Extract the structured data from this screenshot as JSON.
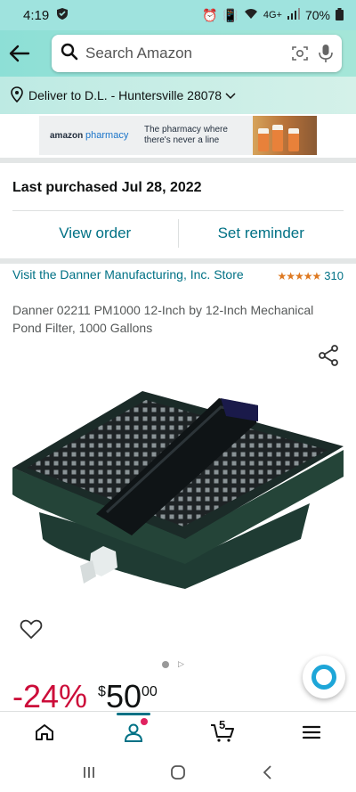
{
  "status_bar": {
    "time": "4:19",
    "network": "4G+",
    "battery": "70%"
  },
  "search": {
    "placeholder": "Search Amazon"
  },
  "delivery": {
    "text": "Deliver to D.L. - Huntersville 28078"
  },
  "ad": {
    "brand": "amazon",
    "brand_sub": "pharmacy",
    "tagline_1": "The pharmacy where",
    "tagline_2": "there's never a line"
  },
  "purchase": {
    "title": "Last purchased Jul 28, 2022",
    "view_order": "View order",
    "set_reminder": "Set reminder"
  },
  "product": {
    "store_link": "Visit the Danner Manufacturing, Inc. Store",
    "rating_stars": "★★★★★",
    "rating_count": "310",
    "title": "Danner 02211 PM1000 12-Inch by 12-Inch Mechanical Pond Filter, 1000 Gallons"
  },
  "price": {
    "discount": "-24%",
    "currency": "$",
    "whole": "50",
    "fraction": "00"
  },
  "cart": {
    "count": "5"
  },
  "colors": {
    "accent": "#007185",
    "discount": "#cc0c39",
    "star": "#de7921",
    "header": "#9fe3de"
  },
  "icons": [
    "back-arrow-icon",
    "search-icon",
    "camera-icon",
    "mic-icon",
    "location-pin-icon",
    "chevron-down-icon",
    "share-icon",
    "heart-icon",
    "home-icon",
    "account-icon",
    "cart-icon",
    "menu-icon"
  ]
}
